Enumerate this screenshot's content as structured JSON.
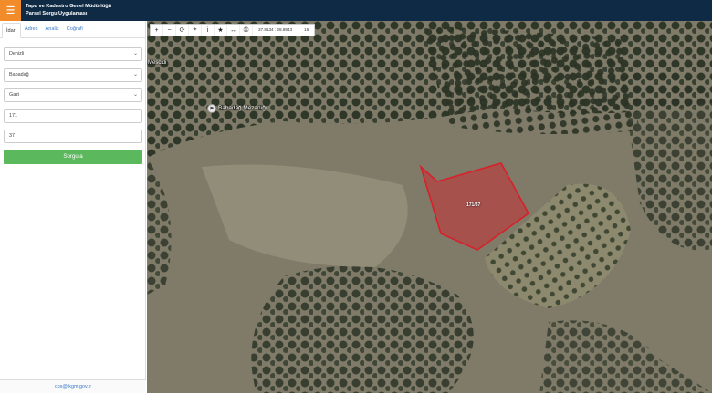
{
  "header": {
    "menu_icon": "☰",
    "title_line1": "Tapu ve Kadastro Genel Müdürlüğü",
    "title_line2": "Parsel Sorgu Uygulaması"
  },
  "tabs": [
    {
      "label": "İdari"
    },
    {
      "label": "Adres"
    },
    {
      "label": "Analiz"
    },
    {
      "label": "Coğrafi"
    }
  ],
  "form": {
    "province": "Denizli",
    "district": "Babadağ",
    "neighborhood": "Gazi",
    "block": "171",
    "parcel": "37",
    "query_label": "Sorgula"
  },
  "footer": {
    "email": "cbs@tkgm.gov.tr"
  },
  "toolbar": {
    "coords": "37.8134 : 28.8943",
    "zoom": "16"
  },
  "map": {
    "place_label": "Mescidi",
    "poi_label": "Babadağ Mezarlığı",
    "parcel_label": "171/37"
  },
  "colors": {
    "header_bg": "#0f2a44",
    "menu_accent": "#f28b2a",
    "query_button": "#5cb85c",
    "link": "#3a78c6",
    "parcel_stroke": "#d8202a"
  }
}
